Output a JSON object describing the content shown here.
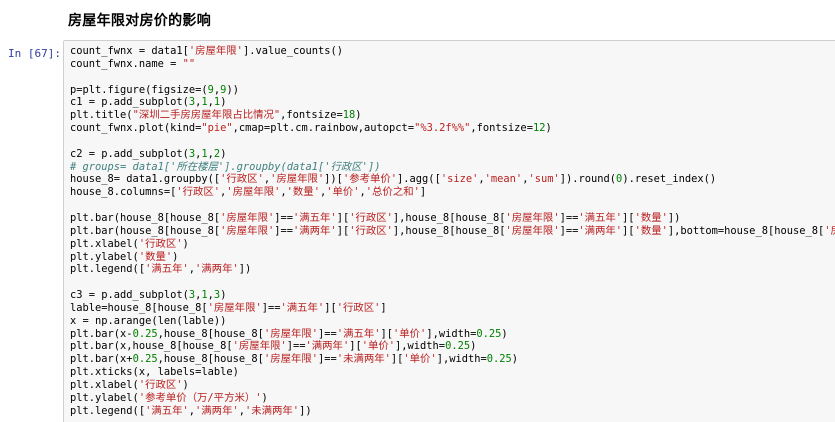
{
  "heading": "房屋年限对房价的影响",
  "prompt": "In [67]:",
  "code_lines": [
    "count_fwnx = data1['房屋年限'].value_counts()",
    "count_fwnx.name = \"\"",
    "",
    "p=plt.figure(figsize=(9,9))",
    "c1 = p.add_subplot(3,1,1)",
    "plt.title(\"深圳二手房房屋年限占比情况\",fontsize=18)",
    "count_fwnx.plot(kind=\"pie\",cmap=plt.cm.rainbow,autopct=\"%3.2f%%\",fontsize=12)",
    "",
    "c2 = p.add_subplot(3,1,2)",
    "# groups= data1['所在楼层'].groupby(data1['行政区'])",
    "house_8= data1.groupby(['行政区','房屋年限'])['参考单价'].agg(['size','mean','sum']).round(0).reset_index()",
    "house_8.columns=['行政区','房屋年限','数量','单价','总价之和']",
    "",
    "plt.bar(house_8[house_8['房屋年限']=='满五年']['行政区'],house_8[house_8['房屋年限']=='满五年']['数量'])",
    "plt.bar(house_8[house_8['房屋年限']=='满两年']['行政区'],house_8[house_8['房屋年限']=='满两年']['数量'],bottom=house_8[house_8['房屋年限']=='满",
    "plt.xlabel('行政区')",
    "plt.ylabel('数量')",
    "plt.legend(['满五年','满两年'])",
    "",
    "c3 = p.add_subplot(3,1,3)",
    "lable=house_8[house_8['房屋年限']=='满五年']['行政区']",
    "x = np.arange(len(lable))",
    "plt.bar(x-0.25,house_8[house_8['房屋年限']=='满五年']['单价'],width=0.25)",
    "plt.bar(x,house_8[house_8['房屋年限']=='满两年']['单价'],width=0.25)",
    "plt.bar(x+0.25,house_8[house_8['房屋年限']=='未满两年']['单价'],width=0.25)",
    "plt.xticks(x, labels=lable)",
    "plt.xlabel('行政区')",
    "plt.ylabel('参考单价（万/平方米）')",
    "plt.legend(['满五年','满两年','未满两年'])"
  ]
}
